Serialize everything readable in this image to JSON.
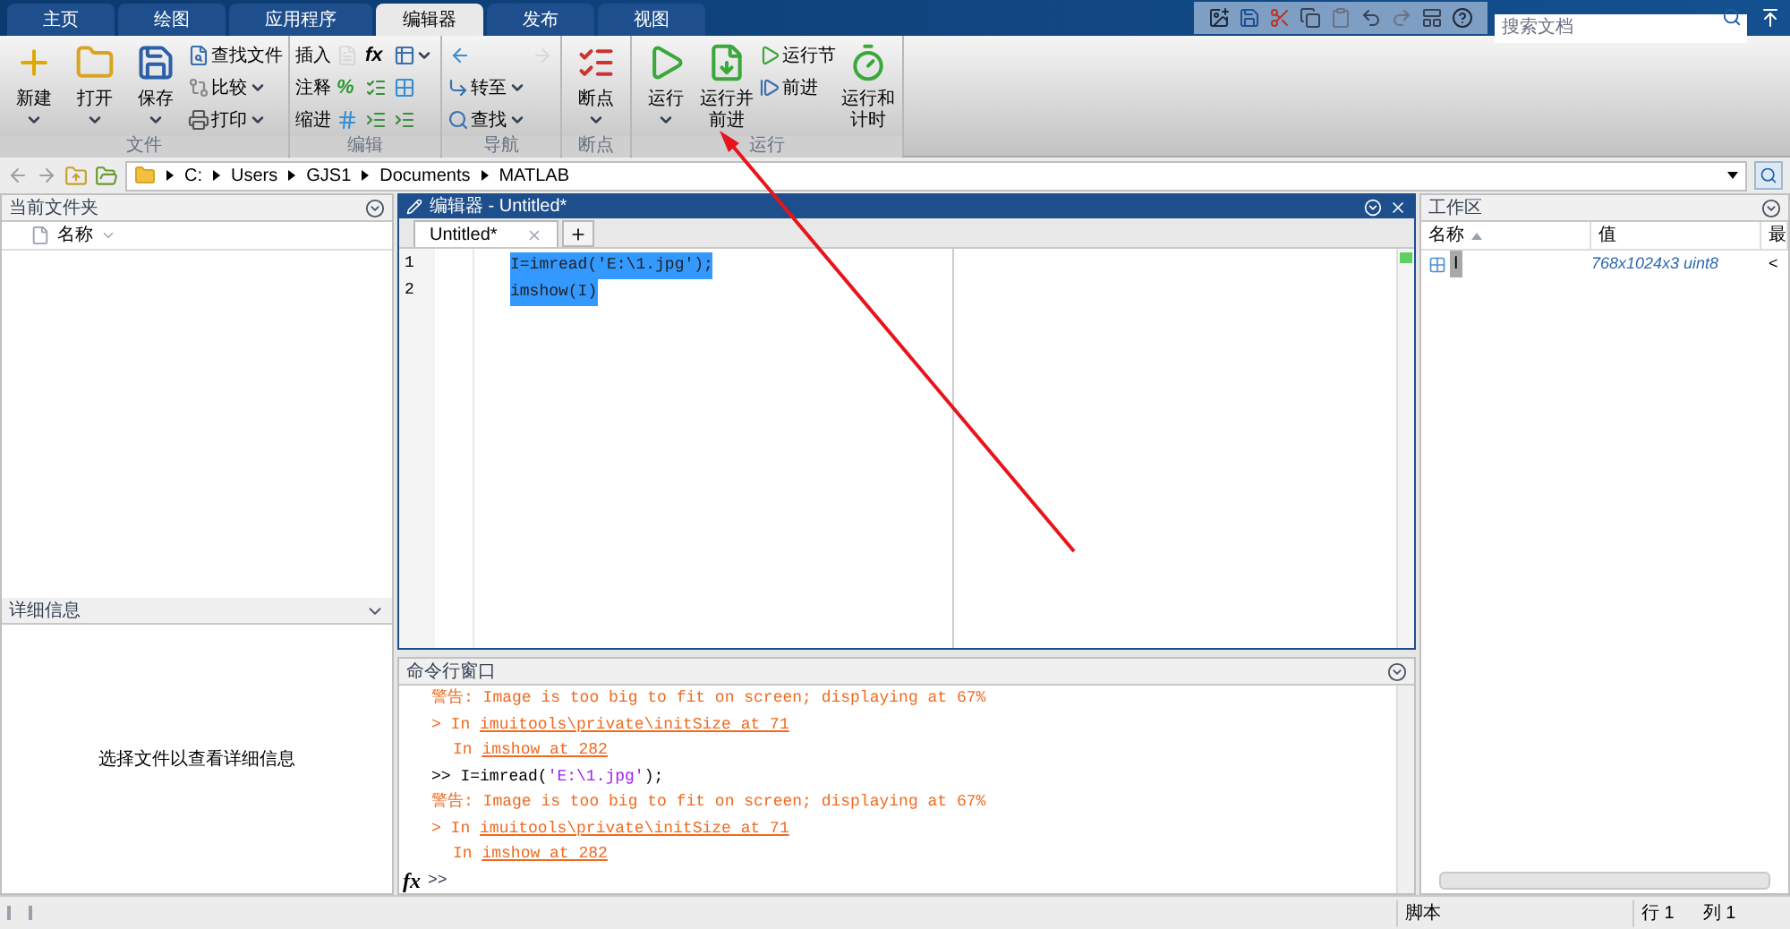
{
  "tabs": [
    {
      "label": "主页",
      "selected": false
    },
    {
      "label": "绘图",
      "selected": false
    },
    {
      "label": "应用程序",
      "selected": false
    },
    {
      "label": "编辑器",
      "selected": true
    },
    {
      "label": "发布",
      "selected": false
    },
    {
      "label": "视图",
      "selected": false
    }
  ],
  "search": {
    "placeholder": "搜索文档"
  },
  "ribbon": [
    {
      "label": "文件",
      "items": [
        {
          "kind": "large",
          "label": "新建",
          "dropdown": true
        },
        {
          "kind": "large",
          "label": "打开",
          "dropdown": true
        },
        {
          "kind": "large",
          "label": "保存",
          "dropdown": true
        },
        {
          "kind": "small",
          "label": "查找文件",
          "dropdown": false
        },
        {
          "kind": "small",
          "label": "比较",
          "dropdown": true
        },
        {
          "kind": "small",
          "label": "打印",
          "dropdown": true
        }
      ]
    },
    {
      "label": "编辑",
      "items": [
        {
          "kind": "small",
          "label": "插入",
          "dropdown": false
        },
        {
          "kind": "small",
          "label": "注释",
          "dropdown": false
        },
        {
          "kind": "small",
          "label": "缩进",
          "dropdown": false
        },
        {
          "kind": "icon",
          "disabled": true,
          "dropdown": false
        },
        {
          "kind": "icon",
          "text": "%",
          "disabled": false,
          "dropdown": false
        },
        {
          "kind": "icon",
          "disabled": false,
          "dropdown": false
        },
        {
          "kind": "icon",
          "text": "fx",
          "disabled": false,
          "dropdown": false
        },
        {
          "kind": "icon",
          "disabled": false,
          "dropdown": false
        },
        {
          "kind": "icon",
          "disabled": false,
          "dropdown": false
        },
        {
          "kind": "icon",
          "disabled": false,
          "dropdown": true
        },
        {
          "kind": "icon",
          "disabled": false,
          "dropdown": false
        },
        {
          "kind": "icon",
          "disabled": false,
          "dropdown": false
        }
      ]
    },
    {
      "label": "导航",
      "items": [
        {
          "kind": "icon",
          "disabled": false,
          "dropdown": false
        },
        {
          "kind": "small",
          "label": "转至",
          "dropdown": true
        },
        {
          "kind": "small",
          "label": "查找",
          "dropdown": true
        },
        {
          "kind": "icon",
          "disabled": true,
          "dropdown": false
        }
      ]
    },
    {
      "label": "断点",
      "items": [
        {
          "kind": "large",
          "label": "断点",
          "dropdown": true
        }
      ]
    },
    {
      "label": "运行",
      "items": [
        {
          "kind": "large",
          "label": "运行",
          "dropdown": true
        },
        {
          "kind": "large",
          "label": "运行并前进",
          "dropdown": false
        },
        {
          "kind": "small",
          "label": "运行节",
          "dropdown": false
        },
        {
          "kind": "small",
          "label": "前进",
          "dropdown": false
        },
        {
          "kind": "large",
          "label": "运行和计时",
          "dropdown": false
        }
      ]
    }
  ],
  "path": [
    "C:",
    "Users",
    "GJS1",
    "Documents",
    "MATLAB"
  ],
  "current_folder": {
    "title": "当前文件夹",
    "column": "名称"
  },
  "details": {
    "title": "详细信息",
    "message": "选择文件以查看详细信息"
  },
  "editor": {
    "title": "编辑器 - Untitled*",
    "tab": "Untitled*",
    "lines": [
      {
        "number": "1",
        "code": "I=imread('E:\\1.jpg');",
        "selected": true
      },
      {
        "number": "2",
        "code": "imshow(I)",
        "selected": true
      }
    ]
  },
  "command_window": {
    "title": "命令行窗口",
    "lines": [
      {
        "kind": "warning",
        "text": "警告: Image is too big to fit on screen; displaying at 67%"
      },
      {
        "kind": "trace",
        "prefix": "> In",
        "link": "imuitools\\private\\initSize at 71"
      },
      {
        "kind": "trace",
        "prefix": "In",
        "link": "imshow at 282"
      },
      {
        "kind": "input",
        "prompt": ">>",
        "code": "I=imread(",
        "string": "'E:\\1.jpg'",
        "tail": ");"
      },
      {
        "kind": "warning",
        "text": "警告: Image is too big to fit on screen; displaying at 67%"
      },
      {
        "kind": "trace",
        "prefix": "> In",
        "link": "imuitools\\private\\initSize at 71"
      },
      {
        "kind": "trace",
        "prefix": "In",
        "link": "imshow at 282"
      }
    ],
    "fx": "fx",
    "prompt": ">>"
  },
  "workspace": {
    "title": "工作区",
    "columns": [
      "名称",
      "值",
      "最"
    ],
    "rows": [
      {
        "name": "I",
        "value": "768x1024x3 uint8",
        "column_3": "<",
        "selected": true
      }
    ]
  },
  "status_bar": {
    "type": "脚本",
    "row_label": "行",
    "row": "1",
    "col_label": "列",
    "col": "1"
  }
}
